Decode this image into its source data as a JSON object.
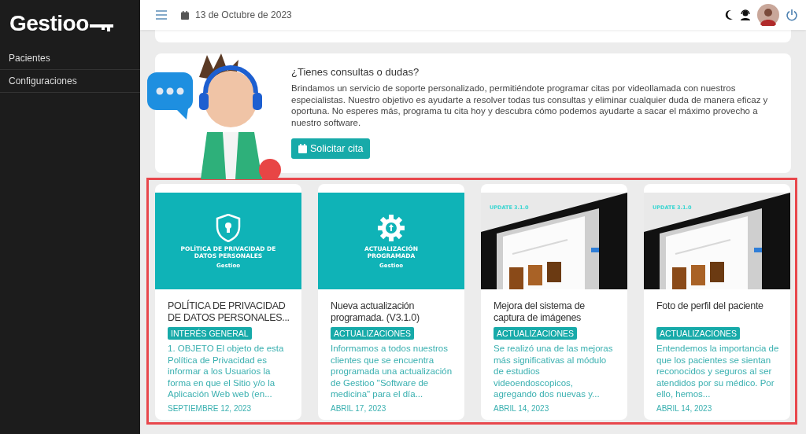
{
  "sidebar": {
    "logo": "Gestioo",
    "items": [
      {
        "label": "Pacientes"
      },
      {
        "label": "Configuraciones"
      }
    ]
  },
  "topbar": {
    "date": "13 de Octubre de 2023"
  },
  "support": {
    "title": "¿Tienes consultas o dudas?",
    "text": "Brindamos un servicio de soporte personalizado, permitiéndote programar citas por videollamada con nuestros especialistas. Nuestro objetivo es ayudarte a resolver todas tus consultas y eliminar cualquier duda de manera eficaz y oportuna. No esperes más, programa tu cita hoy y descubra cómo podemos ayudarte a sacar el máximo provecho a nuestro software.",
    "button": "Solicitar cita"
  },
  "posts": [
    {
      "image": {
        "kind": "shield",
        "headline": "POLÍTICA DE PRIVACIDAD DE DATOS PERSONALES",
        "brand": "Gestioo"
      },
      "title": "POLÍTICA DE PRIVACIDAD DE DATOS PERSONALES...",
      "tag": "INTERÉS GENERAL",
      "excerpt": "1. OBJETO  El objeto de esta Política de Privacidad es informar a los Usuarios la forma en que el Sitio y/o la Aplicación Web web (en...",
      "date": "SEPTIEMBRE 12, 2023"
    },
    {
      "image": {
        "kind": "gear",
        "headline": "ACTUALIZACIÓN PROGRAMADA",
        "brand": "Gestioo"
      },
      "title": "Nueva actualización programada. (V3.1.0)",
      "tag": "ACTUALIZACIONES",
      "excerpt": "Informamos a todos nuestros clientes que se encuentra programada una actualización de Gestioo \"Software de medicina\" para el día...",
      "date": "ABRIL 17, 2023"
    },
    {
      "image": {
        "kind": "screenshot",
        "badge": "UPDATE 3.1.0"
      },
      "title": "Mejora del sistema de captura de imágenes",
      "tag": "ACTUALIZACIONES",
      "excerpt": "Se realizó una de las mejoras más significativas al módulo de estudios videoendoscopicos, agregando dos nuevas y...",
      "date": "ABRIL 14, 2023"
    },
    {
      "image": {
        "kind": "screenshot",
        "badge": "UPDATE 3.1.0"
      },
      "title": "Foto de perfil del paciente",
      "tag": "ACTUALIZACIONES",
      "excerpt": "Entendemos la importancia de que los pacientes se sientan reconocidos y seguros al ser atendidos por su médico. Por ello, hemos...",
      "date": "ABRIL 14, 2023"
    }
  ]
}
